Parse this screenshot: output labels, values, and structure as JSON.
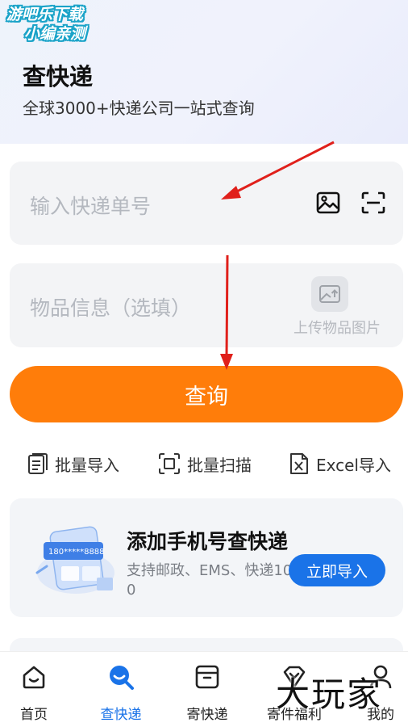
{
  "watermark_top": {
    "line1": "游吧乐下载",
    "line2": "小编亲测"
  },
  "header": {
    "title": "查快递",
    "subtitle": "全球3000+快递公司一站式查询"
  },
  "tracking_input": {
    "placeholder": "输入快递单号",
    "image_icon": "image-icon",
    "scan_icon": "scan-icon"
  },
  "item_input": {
    "placeholder": "物品信息（选填）",
    "upload_label": "上传物品图片",
    "upload_icon": "image-upload-icon"
  },
  "query_button": {
    "label": "查询",
    "color": "#ff7d0a"
  },
  "quick_actions": [
    {
      "label": "批量导入",
      "icon": "batch-import-icon"
    },
    {
      "label": "批量扫描",
      "icon": "batch-scan-icon"
    },
    {
      "label": "Excel导入",
      "icon": "excel-icon"
    }
  ],
  "promo": {
    "title": "添加手机号查快递",
    "description": "支持邮政、EMS、快递100",
    "button_label": "立即导入",
    "phone_text": "180*****8888",
    "accent": "#1a73e8"
  },
  "tabbar": {
    "active_index": 1,
    "items": [
      {
        "label": "首页",
        "icon": "home-icon"
      },
      {
        "label": "查快递",
        "icon": "search-package-icon"
      },
      {
        "label": "寄快递",
        "icon": "box-icon"
      },
      {
        "label": "寄件福利",
        "icon": "gift-icon"
      },
      {
        "label": "我的",
        "icon": "profile-icon"
      }
    ]
  },
  "watermark_bottom": "大玩家"
}
